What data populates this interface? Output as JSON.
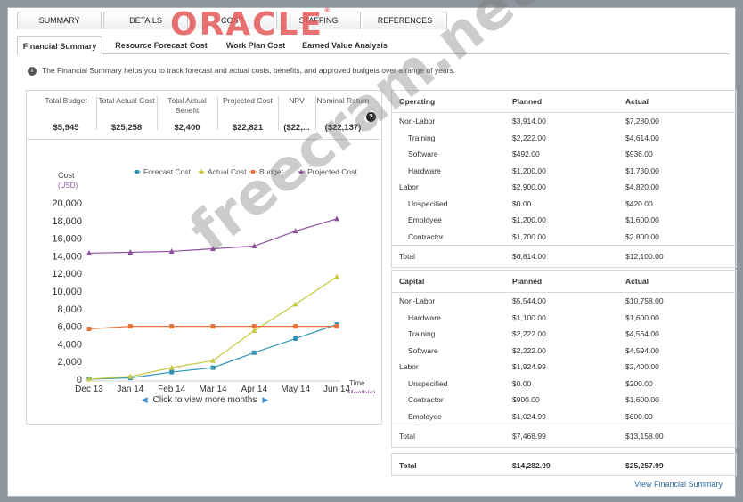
{
  "logo": "ORACLE",
  "logo_mark": "®",
  "top_tabs": [
    "SUMMARY",
    "DETAILS",
    "COST",
    "STAFFING",
    "REFERENCES"
  ],
  "sub_tabs": [
    "Financial Summary",
    "Resource Forecast Cost",
    "Work Plan Cost",
    "Earned Value Analysis"
  ],
  "info": {
    "icon": "info-icon",
    "text": "The Financial Summary helps you to track forecast and actual costs, benefits, and approved budgets over a range of years."
  },
  "metrics": [
    {
      "label": "Total Budget",
      "value": "$5,945"
    },
    {
      "label": "Total Actual Cost",
      "value": "$25,258"
    },
    {
      "label": "Total Actual Benefit",
      "value": "$2,400"
    },
    {
      "label": "Projected Cost",
      "value": "$22,821"
    },
    {
      "label": "NPV",
      "value": "($22,..."
    },
    {
      "label": "Nominal Return",
      "value": "($22,137)"
    }
  ],
  "help_icon": "?",
  "chart_data": {
    "type": "line",
    "ylabel": "Cost",
    "yunit": "(USD)",
    "xlabel": "Time",
    "xunit": "Month(s)",
    "ylim": [
      0,
      20000
    ],
    "yticks": [
      "20,000",
      "18,000",
      "16,000",
      "14,000",
      "12,000",
      "10,000",
      "8,000",
      "6,000",
      "4,000",
      "2,000",
      "0"
    ],
    "categories": [
      "Dec 13",
      "Jan 14",
      "Feb 14",
      "Mar 14",
      "Apr 14",
      "May 14",
      "Jun 14"
    ],
    "legend_position": "top",
    "series": [
      {
        "name": "Forecast Cost",
        "color": "#2f96b4",
        "marker": "square",
        "values": [
          0,
          150,
          800,
          1300,
          3000,
          4600,
          6200
        ]
      },
      {
        "name": "Actual Cost",
        "color": "#c7c93a",
        "marker": "triangle",
        "values": [
          0,
          300,
          1300,
          2100,
          5500,
          8500,
          11600
        ]
      },
      {
        "name": "Budget",
        "color": "#e8743b",
        "marker": "square",
        "values": [
          5700,
          6000,
          6000,
          6000,
          6000,
          6000,
          6000
        ]
      },
      {
        "name": "Projected Cost",
        "color": "#8e4e9e",
        "marker": "triangle",
        "values": [
          14300,
          14400,
          14500,
          14800,
          15100,
          16800,
          18200
        ]
      }
    ]
  },
  "chart_nav": {
    "text": "Click to view more months",
    "prev_icon": "chevron-left-icon",
    "next_icon": "chevron-right-icon"
  },
  "operating": {
    "headers": [
      "Operating",
      "Planned",
      "Actual"
    ],
    "rows": [
      {
        "label": "Non-Labor",
        "indent": false,
        "planned": "$3,914.00",
        "actual": "$7,280.00"
      },
      {
        "label": "Training",
        "indent": true,
        "planned": "$2,222.00",
        "actual": "$4,614.00"
      },
      {
        "label": "Software",
        "indent": true,
        "planned": "$492.00",
        "actual": "$936.00"
      },
      {
        "label": "Hardware",
        "indent": true,
        "planned": "$1,200.00",
        "actual": "$1,730.00"
      },
      {
        "label": "Labor",
        "indent": false,
        "planned": "$2,900.00",
        "actual": "$4,820.00"
      },
      {
        "label": "Unspecified",
        "indent": true,
        "planned": "$0.00",
        "actual": "$420.00"
      },
      {
        "label": "Employee",
        "indent": true,
        "planned": "$1,200.00",
        "actual": "$1,600.00"
      },
      {
        "label": "Contractor",
        "indent": true,
        "planned": "$1,700.00",
        "actual": "$2,800.00"
      }
    ],
    "total": {
      "label": "Total",
      "planned": "$6,814.00",
      "actual": "$12,100.00"
    }
  },
  "capital": {
    "headers": [
      "Capital",
      "Planned",
      "Actual"
    ],
    "rows": [
      {
        "label": "Non-Labor",
        "indent": false,
        "planned": "$5,544.00",
        "actual": "$10,758.00"
      },
      {
        "label": "Hardware",
        "indent": true,
        "planned": "$1,100.00",
        "actual": "$1,600.00"
      },
      {
        "label": "Training",
        "indent": true,
        "planned": "$2,222.00",
        "actual": "$4,564.00"
      },
      {
        "label": "Software",
        "indent": true,
        "planned": "$2,222.00",
        "actual": "$4,594.00"
      },
      {
        "label": "Labor",
        "indent": false,
        "planned": "$1,924.99",
        "actual": "$2,400.00"
      },
      {
        "label": "Unspecified",
        "indent": true,
        "planned": "$0.00",
        "actual": "$200.00"
      },
      {
        "label": "Contractor",
        "indent": true,
        "planned": "$900.00",
        "actual": "$1,600.00"
      },
      {
        "label": "Employee",
        "indent": true,
        "planned": "$1,024.99",
        "actual": "$600.00"
      }
    ],
    "total": {
      "label": "Total",
      "planned": "$7,468.99",
      "actual": "$13,158.00"
    }
  },
  "grand_total": {
    "label": "Total",
    "planned": "$14,282.99",
    "actual": "$25,257.99"
  },
  "view_link": "View Financial Summary",
  "watermark": "freecram.net"
}
